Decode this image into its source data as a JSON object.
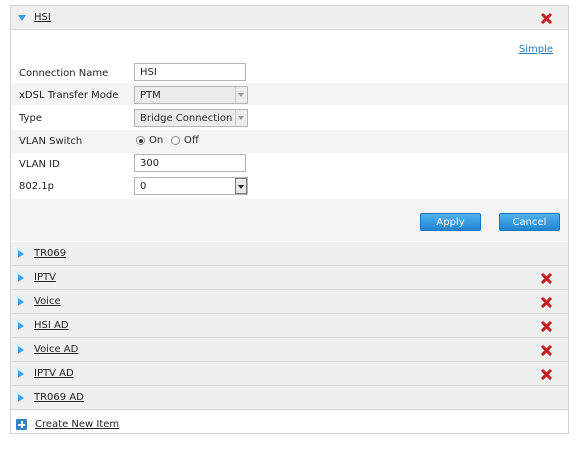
{
  "expanded_item": {
    "title": "HSI",
    "simple_link": "Simple",
    "fields": {
      "connection_name": {
        "label": "Connection Name",
        "value": "HSI"
      },
      "xdsl_transfer_mode": {
        "label": "xDSL Transfer Mode",
        "value": "PTM"
      },
      "type": {
        "label": "Type",
        "value": "Bridge Connection"
      },
      "vlan_switch": {
        "label": "VLAN Switch",
        "on_label": "On",
        "off_label": "Off",
        "selected": "On"
      },
      "vlan_id": {
        "label": "VLAN ID",
        "value": "300"
      },
      "dot1p": {
        "label": "802.1p",
        "value": "0"
      }
    },
    "apply_label": "Apply",
    "cancel_label": "Cancel"
  },
  "collapsed_items": [
    {
      "label": "TR069",
      "deletable": false
    },
    {
      "label": "IPTV",
      "deletable": true
    },
    {
      "label": "Voice",
      "deletable": true
    },
    {
      "label": "HSI AD",
      "deletable": true
    },
    {
      "label": "Voice AD",
      "deletable": true
    },
    {
      "label": "IPTV AD",
      "deletable": true
    },
    {
      "label": "TR069 AD",
      "deletable": false
    }
  ],
  "create_new_label": "Create New Item",
  "colors": {
    "accent": "#3d9de0",
    "delete": "#c42020",
    "button": "#2a8fd8"
  }
}
